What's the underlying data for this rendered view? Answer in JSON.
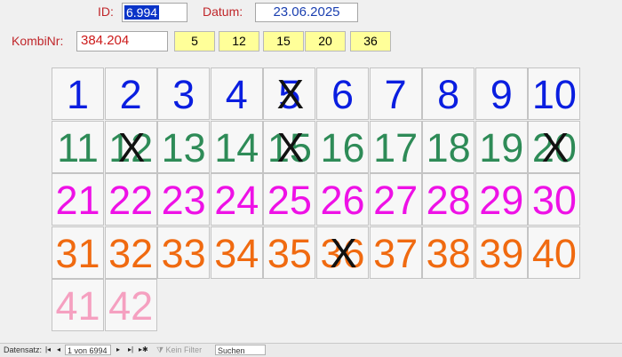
{
  "form": {
    "id_label": "ID:",
    "id_value": "6.994",
    "date_label": "Datum:",
    "date_value": "23.06.2025",
    "kombi_label": "KombiNr:",
    "kombi_value": "384.204",
    "drawn_numbers": [
      "5",
      "12",
      "15",
      "20",
      "36"
    ]
  },
  "grid": {
    "colors": {
      "row1": "#0a1ee0",
      "row2": "#2e8b57",
      "row3": "#ee11e6",
      "row4": "#f06a10",
      "row5": "#f5a0c0"
    },
    "cells": [
      {
        "n": "1",
        "c": "row1",
        "x": false
      },
      {
        "n": "2",
        "c": "row1",
        "x": false
      },
      {
        "n": "3",
        "c": "row1",
        "x": false
      },
      {
        "n": "4",
        "c": "row1",
        "x": false
      },
      {
        "n": "5",
        "c": "row1",
        "x": true
      },
      {
        "n": "6",
        "c": "row1",
        "x": false
      },
      {
        "n": "7",
        "c": "row1",
        "x": false
      },
      {
        "n": "8",
        "c": "row1",
        "x": false
      },
      {
        "n": "9",
        "c": "row1",
        "x": false
      },
      {
        "n": "10",
        "c": "row1",
        "x": false
      },
      {
        "n": "11",
        "c": "row2",
        "x": false
      },
      {
        "n": "12",
        "c": "row2",
        "x": true
      },
      {
        "n": "13",
        "c": "row2",
        "x": false
      },
      {
        "n": "14",
        "c": "row2",
        "x": false
      },
      {
        "n": "15",
        "c": "row2",
        "x": true
      },
      {
        "n": "16",
        "c": "row2",
        "x": false
      },
      {
        "n": "17",
        "c": "row2",
        "x": false
      },
      {
        "n": "18",
        "c": "row2",
        "x": false
      },
      {
        "n": "19",
        "c": "row2",
        "x": false
      },
      {
        "n": "20",
        "c": "row2",
        "x": true
      },
      {
        "n": "21",
        "c": "row3",
        "x": false
      },
      {
        "n": "22",
        "c": "row3",
        "x": false
      },
      {
        "n": "23",
        "c": "row3",
        "x": false
      },
      {
        "n": "24",
        "c": "row3",
        "x": false
      },
      {
        "n": "25",
        "c": "row3",
        "x": false
      },
      {
        "n": "26",
        "c": "row3",
        "x": false
      },
      {
        "n": "27",
        "c": "row3",
        "x": false
      },
      {
        "n": "28",
        "c": "row3",
        "x": false
      },
      {
        "n": "29",
        "c": "row3",
        "x": false
      },
      {
        "n": "30",
        "c": "row3",
        "x": false
      },
      {
        "n": "31",
        "c": "row4",
        "x": false
      },
      {
        "n": "32",
        "c": "row4",
        "x": false
      },
      {
        "n": "33",
        "c": "row4",
        "x": false
      },
      {
        "n": "34",
        "c": "row4",
        "x": false
      },
      {
        "n": "35",
        "c": "row4",
        "x": false
      },
      {
        "n": "36",
        "c": "row4",
        "x": true
      },
      {
        "n": "37",
        "c": "row4",
        "x": false
      },
      {
        "n": "38",
        "c": "row4",
        "x": false
      },
      {
        "n": "39",
        "c": "row4",
        "x": false
      },
      {
        "n": "40",
        "c": "row4",
        "x": false
      },
      {
        "n": "41",
        "c": "row5",
        "x": false
      },
      {
        "n": "42",
        "c": "row5",
        "x": false
      }
    ],
    "mark_symbol": "X"
  },
  "statusbar": {
    "label": "Datensatz:",
    "nav_first_icon": "first-record-icon",
    "nav_prev_icon": "prev-record-icon",
    "record_text": "1 von 6994",
    "nav_next_icon": "next-record-icon",
    "nav_last_icon": "last-record-icon",
    "nav_new_icon": "new-record-icon",
    "filter_icon": "filter-icon",
    "filter_text": "Kein Filter",
    "search_placeholder": "Suchen"
  }
}
